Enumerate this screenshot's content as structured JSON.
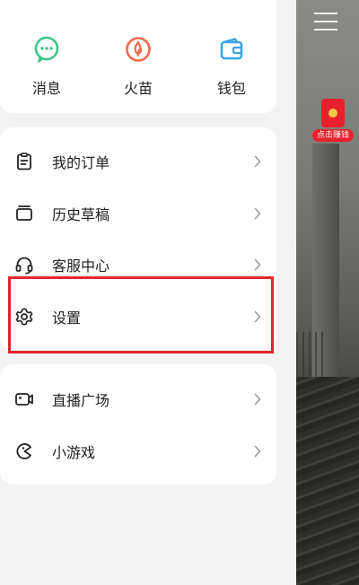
{
  "quick_actions": [
    {
      "label": "消息",
      "icon": "message-icon",
      "color": "#3cc48c"
    },
    {
      "label": "火苗",
      "icon": "flame-icon",
      "color": "#f06a4a"
    },
    {
      "label": "钱包",
      "icon": "wallet-icon",
      "color": "#3aa6e6"
    }
  ],
  "menu": [
    {
      "label": "我的订单",
      "icon": "order-clipboard-icon"
    },
    {
      "label": "历史草稿",
      "icon": "draft-box-icon"
    },
    {
      "label": "客服中心",
      "icon": "headset-icon"
    },
    {
      "label": "设置",
      "icon": "gear-icon"
    }
  ],
  "extra_menu": [
    {
      "label": "直播广场",
      "icon": "live-camera-icon"
    },
    {
      "label": "小游戏",
      "icon": "game-pacman-icon"
    }
  ],
  "overlay": {
    "red_packet_label": "点击赚钱",
    "highlight_color": "#e3262c"
  }
}
